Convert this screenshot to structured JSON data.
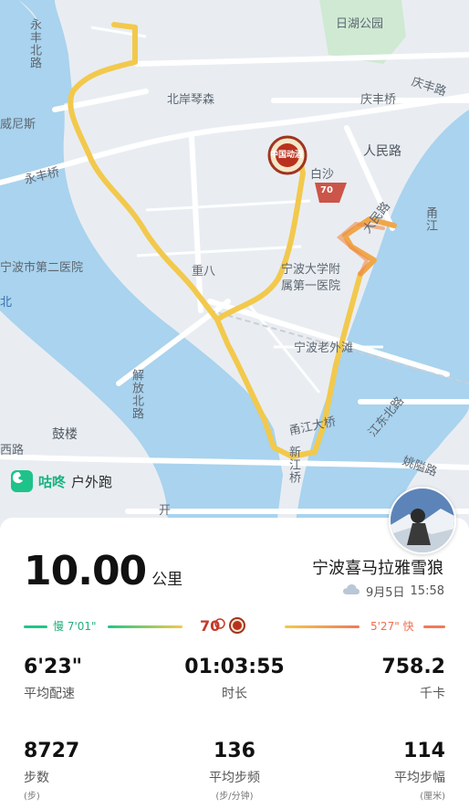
{
  "map": {
    "labels": {
      "rihu_park": "日湖公园",
      "yongfeng_north": "永丰北路",
      "beian_qinsen": "北岸琴森",
      "qingfeng_bridge": "庆丰桥",
      "qingfeng_road": "庆丰路",
      "weinisi": "威尼斯",
      "renmin_road": "人民路",
      "yongfeng_bridge": "永丰桥",
      "baisha": "白沙",
      "daminlu": "大民路",
      "yongjiang": "甬江",
      "second_hospital": "宁波市第二医院",
      "zhongba": "重八",
      "ndfy": "宁波大学附属第一医院",
      "ndfy_line1": "宁波大学附",
      "ndfy_line2": "属第一医院",
      "laowaitan": "宁波老外滩",
      "jiefang_north": "解放北路",
      "gulou": "鼓楼",
      "yongjiang_bridge": "甬江大桥",
      "jiangdong_north": "江东北路",
      "xinjiang_bridge": "新江桥",
      "xi_road": "西路",
      "yaoai_road": "姚隘路",
      "kai": "开"
    },
    "badge_text": "中国动酒",
    "badge_subtext": "70",
    "north_edge_char": "北"
  },
  "app": {
    "name": "咕咚",
    "mode": "户外跑",
    "logo_icon": "gudong-logo-icon"
  },
  "summary": {
    "distance": "10.00",
    "distance_unit": "公里",
    "user_name": "宁波喜马拉雅雪狼",
    "weather_icon": "cloud-icon",
    "date": "9月5日",
    "time": "15:58"
  },
  "pace_bar": {
    "slow_label": "慢 7'01\"",
    "fast_label": "5'27\" 快",
    "slow_color": "#22c58a",
    "fast_color": "#f07a5a",
    "route_color": "#f2c94c"
  },
  "stats": {
    "avg_pace": {
      "value": "6'23\"",
      "label": "平均配速"
    },
    "duration": {
      "value": "01:03:55",
      "label": "时长"
    },
    "calories": {
      "value": "758.2",
      "label": "千卡"
    },
    "steps": {
      "value": "8727",
      "label": "步数",
      "unit": "(步)"
    },
    "cadence": {
      "value": "136",
      "label": "平均步频",
      "unit": "(步/分钟)"
    },
    "stride": {
      "value": "114",
      "label": "平均步幅",
      "unit": "(厘米)"
    }
  }
}
